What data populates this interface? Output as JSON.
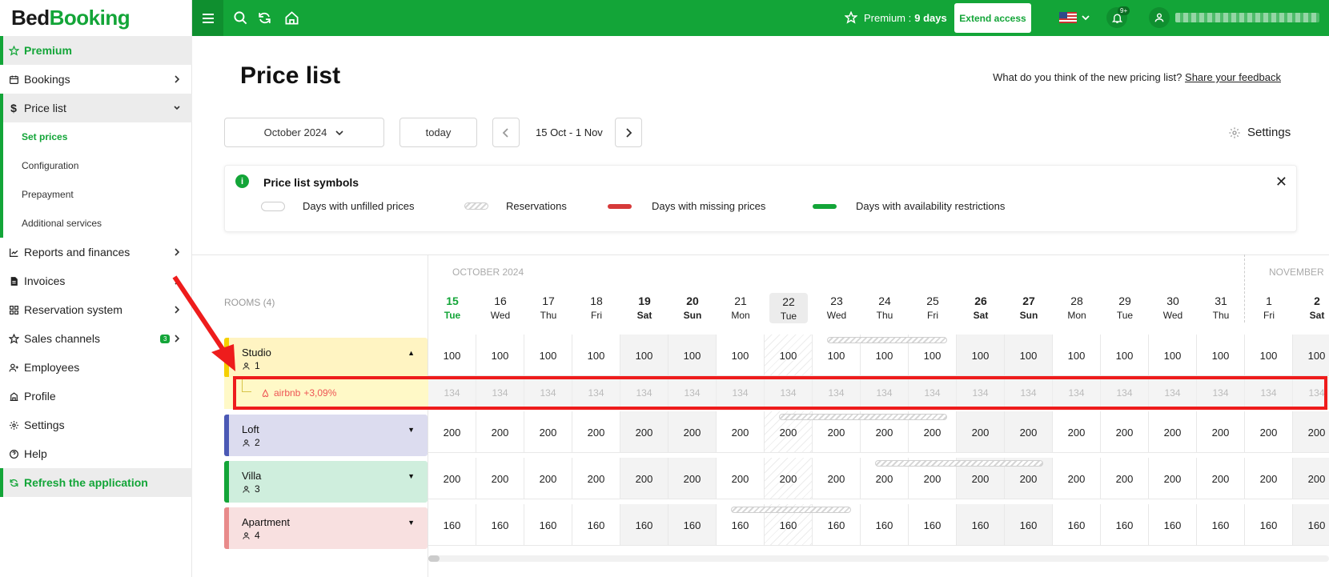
{
  "logo": {
    "part1": "Bed",
    "part2": "Booking"
  },
  "sidebar": {
    "items": [
      {
        "label": "Premium",
        "icon": "star-icon"
      },
      {
        "label": "Bookings",
        "icon": "calendar-icon"
      },
      {
        "label": "Price list",
        "icon": "dollar-icon"
      },
      {
        "label": "Set prices"
      },
      {
        "label": "Configuration"
      },
      {
        "label": "Prepayment"
      },
      {
        "label": "Additional services"
      },
      {
        "label": "Reports and finances",
        "icon": "chart-icon"
      },
      {
        "label": "Invoices",
        "icon": "document-icon"
      },
      {
        "label": "Reservation system",
        "icon": "grid-icon"
      },
      {
        "label": "Sales channels",
        "icon": "star-icon",
        "badge": "3"
      },
      {
        "label": "Employees",
        "icon": "user-plus-icon"
      },
      {
        "label": "Profile",
        "icon": "building-icon"
      },
      {
        "label": "Settings",
        "icon": "gear-icon"
      },
      {
        "label": "Help",
        "icon": "help-icon"
      },
      {
        "label": "Refresh the application",
        "icon": "refresh-icon"
      }
    ]
  },
  "topbar": {
    "premium_label": "Premium :",
    "premium_days": "9 days",
    "extend_label": "Extend access",
    "notif_count": "9+",
    "accent": "#13a538"
  },
  "header": {
    "title": "Price list",
    "feedback_question": "What do you think of the new pricing list?",
    "feedback_link": "Share your feedback",
    "month_select": "October 2024",
    "today_label": "today",
    "range": "15 Oct - 1 Nov",
    "settings_label": "Settings"
  },
  "symbols": {
    "title": "Price list symbols",
    "info": "i",
    "close": "✕",
    "items": [
      "Days with unfilled prices",
      "Reservations",
      "Days with missing prices",
      "Days with availability restrictions"
    ]
  },
  "grid": {
    "rooms_header": "ROOMS (4)",
    "months": [
      "OCTOBER 2024",
      "NOVEMBER"
    ],
    "days": [
      {
        "num": "15",
        "dow": "Tue"
      },
      {
        "num": "16",
        "dow": "Wed"
      },
      {
        "num": "17",
        "dow": "Thu"
      },
      {
        "num": "18",
        "dow": "Fri"
      },
      {
        "num": "19",
        "dow": "Sat"
      },
      {
        "num": "20",
        "dow": "Sun"
      },
      {
        "num": "21",
        "dow": "Mon"
      },
      {
        "num": "22",
        "dow": "Tue"
      },
      {
        "num": "23",
        "dow": "Wed"
      },
      {
        "num": "24",
        "dow": "Thu"
      },
      {
        "num": "25",
        "dow": "Fri"
      },
      {
        "num": "26",
        "dow": "Sat"
      },
      {
        "num": "27",
        "dow": "Sun"
      },
      {
        "num": "28",
        "dow": "Mon"
      },
      {
        "num": "29",
        "dow": "Tue"
      },
      {
        "num": "30",
        "dow": "Wed"
      },
      {
        "num": "31",
        "dow": "Thu"
      },
      {
        "num": "1",
        "dow": "Fri"
      },
      {
        "num": "2",
        "dow": "Sat"
      }
    ],
    "rooms": [
      {
        "name": "Studio",
        "capacity": "1",
        "price": "100",
        "color": "#fff4c2",
        "strip": "#f5d000",
        "expanded": true
      },
      {
        "name": "Loft",
        "capacity": "2",
        "price": "200",
        "color": "#dcdcef",
        "strip": "#4b59b5",
        "expanded": false
      },
      {
        "name": "Villa",
        "capacity": "3",
        "price": "200",
        "color": "#cfeedd",
        "strip": "#13a538",
        "expanded": false
      },
      {
        "name": "Apartment",
        "capacity": "4",
        "price": "160",
        "color": "#f8e0e0",
        "strip": "#e88a8a",
        "expanded": false
      }
    ],
    "channel_row": {
      "name": "airbnb",
      "markup": "+3,09%",
      "price": "134"
    }
  }
}
